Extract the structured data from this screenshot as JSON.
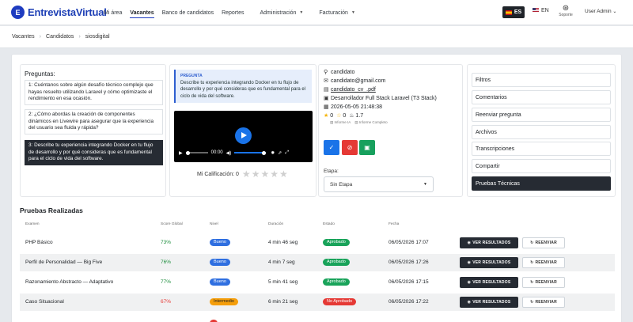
{
  "app": {
    "brand_initial": "E",
    "name": "EntrevistaVirtual"
  },
  "nav": [
    {
      "label": "Mi área",
      "has_menu": false,
      "active": false
    },
    {
      "label": "Vacantes",
      "has_menu": false,
      "active": true
    },
    {
      "label": "Banco de candidatos",
      "has_menu": false,
      "active": false
    },
    {
      "label": "Reportes",
      "has_menu": false,
      "active": false
    },
    {
      "label": "Administración",
      "has_menu": true,
      "active": false
    },
    {
      "label": "Facturación",
      "has_menu": true,
      "active": false
    }
  ],
  "lang": {
    "es": "ES",
    "en": "EN"
  },
  "support": {
    "label": "Soporte"
  },
  "user": {
    "label": "User Admin",
    "caret": "⌄"
  },
  "breadcrumb": [
    "Vacantes",
    "Candidatos",
    "siosdigital"
  ],
  "preguntas": {
    "title": "Preguntas:",
    "items": [
      "1: Cuéntanos sobre algún desafío técnico complejo que hayas resuelto utilizando Laravel y cómo optimizaste el rendimiento en esa ocasión.",
      "2: ¿Cómo abordas la creación de componentes dinámicos en Livewire para asegurar que la experiencia del usuario sea fluida y rápida?",
      "3: Describe tu experiencia integrando Docker en tu flujo de desarrollo y por qué consideras que es fundamental para el ciclo de vida del software."
    ],
    "selected": 2
  },
  "pregunta_actual": {
    "label": "PREGUNTA",
    "text": "Describe tu experiencia integrando Docker en tu flujo de desarrollo y por qué consideras que es fundamental para el ciclo de vida del software."
  },
  "video": {
    "time": "00:00"
  },
  "mi_calificacion": {
    "label": "Mi Calificación: 0",
    "stars": 5
  },
  "candidato": {
    "name": "candidato",
    "email": "candidato@gmail.com",
    "cv": "candidato_cv_.pdf",
    "position": "Desarrollador Full Stack Laravel (T3 Stack)",
    "datetime": "2026-05-05 21:48:38",
    "score_stars": "0",
    "score_thumb": "0",
    "score_fire": "1.7",
    "informe_ia": "Informe IA",
    "informe_completo": "Informe Completo"
  },
  "etapa": {
    "label": "Etapa:",
    "value": "Sin Etapa"
  },
  "side_menu": [
    "Filtros",
    "Comentarios",
    "Reenviar pregunta",
    "Archivos",
    "Transcripciones",
    "Compartir",
    "Pruebas Técnicas"
  ],
  "pruebas": {
    "title": "Pruebas Realizadas",
    "headers": [
      "Examen",
      "Score Global",
      "Nivel",
      "Duración",
      "Estado",
      "Fecha"
    ],
    "ver_label": "VER RESULTADOS",
    "reenviar_label": "REENVIAR",
    "rows": [
      {
        "examen": "PHP Básico",
        "score": "73%",
        "nivel": "Bueno",
        "duracion": "4 min 46 seg",
        "estado": "Aprobado",
        "fecha": "06/05/2026 17:07"
      },
      {
        "examen": "Perfil de Personalidad — Big Five",
        "score": "76%",
        "nivel": "Bueno",
        "duracion": "4 min 7 seg",
        "estado": "Aprobado",
        "fecha": "06/05/2026 17:26"
      },
      {
        "examen": "Razonamiento Abstracto — Adaptativo",
        "score": "77%",
        "nivel": "Bueno",
        "duracion": "5 min 41 seg",
        "estado": "Aprobado",
        "fecha": "06/05/2026 17:15"
      },
      {
        "examen": "Caso Situacional",
        "score": "67%",
        "nivel": "Intermedio",
        "duracion": "6 min 21 seg",
        "estado": "No Aprobado",
        "fecha": "06/05/2026 17:22"
      }
    ]
  },
  "colors": {
    "brand": "#1e3cc0",
    "good": "#1e8e3e",
    "bad": "#e53935",
    "nivel_bueno": "#2f6fe0",
    "nivel_intermedio": "#f59e0b",
    "aprobado": "#19a35a",
    "no_aprobado": "#e53935"
  }
}
